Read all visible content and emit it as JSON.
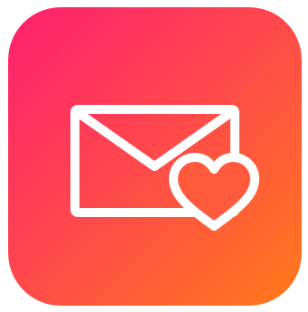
{
  "app_icon": {
    "icon": "envelope-heart-icon",
    "gradient_colors": {
      "top_left": "#FF1F70",
      "middle": "#FF4A4A",
      "bottom_right": "#FF7A1A"
    },
    "glyph_color": "#FFFFFF"
  }
}
